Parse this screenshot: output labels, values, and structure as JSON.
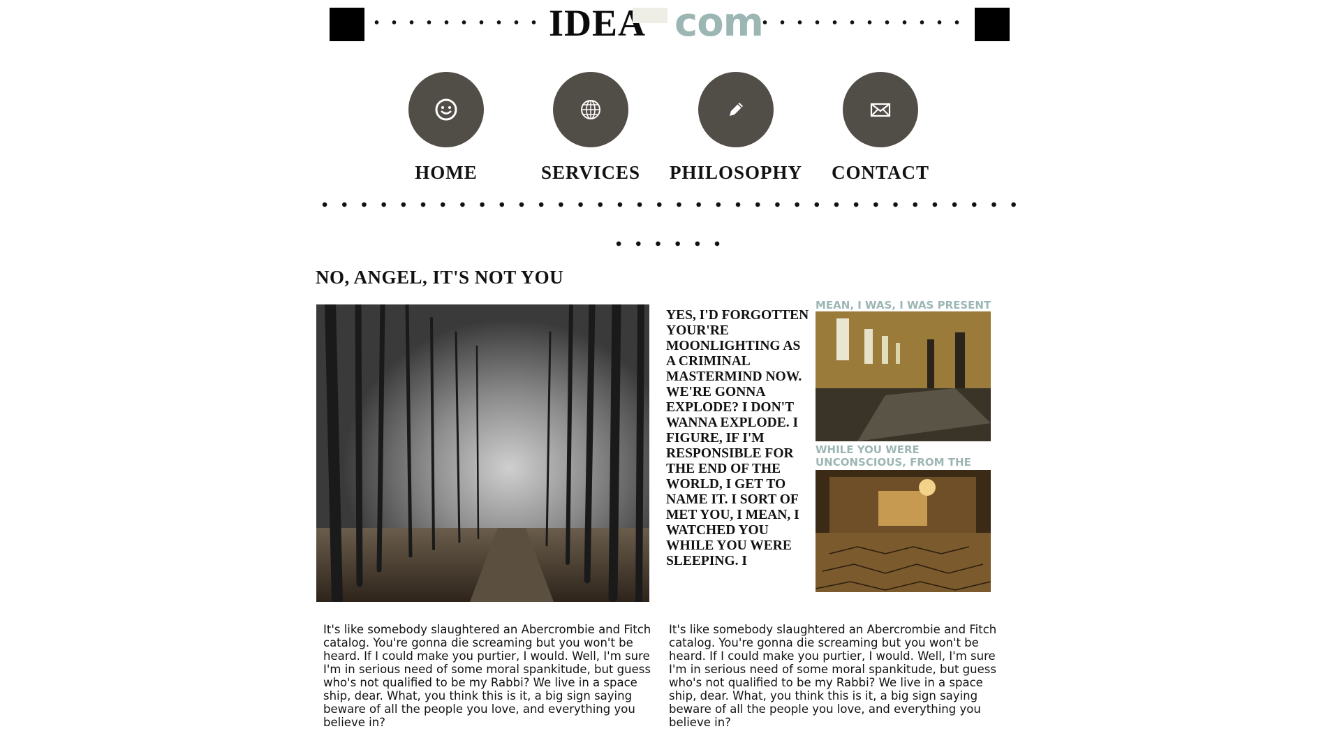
{
  "header": {
    "logo_left": "IDEA",
    "logo_right": "com"
  },
  "nav": {
    "items": [
      {
        "label": "HOME",
        "icon": "smiley-icon"
      },
      {
        "label": "SERVICES",
        "icon": "globe-icon"
      },
      {
        "label": "PHILOSOPHY",
        "icon": "pencil-icon"
      },
      {
        "label": "CONTACT",
        "icon": "envelope-icon"
      }
    ]
  },
  "main": {
    "title": "NO, ANGEL, IT'S NOT YOU",
    "quote": "YES, I'D FORGOTTEN YOUR'RE MOONLIGHTING AS A CRIMINAL MASTERMIND NOW. WE'RE GONNA EXPLODE? I DON'T WANNA EXPLODE. I FIGURE, IF I'M RESPONSIBLE FOR THE END OF THE WORLD, I GET TO NAME IT. I SORT OF MET YOU, I MEAN, I WATCHED YOU WHILE YOU WERE SLEEPING. I",
    "side": [
      {
        "caption": "MEAN, I WAS, I WAS PRESENT"
      },
      {
        "caption": "WHILE YOU WERE UNCONSCIOUS, FROM THE ICE."
      }
    ],
    "paragraphs": [
      "It's like somebody slaughtered an Abercrombie and Fitch catalog. You're gonna die screaming but you won't be heard. If I could make you purtier, I would. Well, I'm sure I'm in serious need of some moral spankitude, but guess who's not qualified to be my Rabbi? We live in a space ship, dear. What, you think this is it, a big sign saying beware of all the people you love, and everything you believe in?",
      "It's like somebody slaughtered an Abercrombie and Fitch catalog. You're gonna die screaming but you won't be heard. If I could make you purtier, I would. Well, I'm sure I'm in serious need of some moral spankitude, but guess who's not qualified to be my Rabbi? We live in a space ship, dear. What, you think this is it, a big sign saying beware of all the people you love, and everything you believe in?"
    ]
  },
  "colors": {
    "accent": "#9cb6b4",
    "nav_circle": "#514d47",
    "logo_gap": "#eeede6"
  }
}
